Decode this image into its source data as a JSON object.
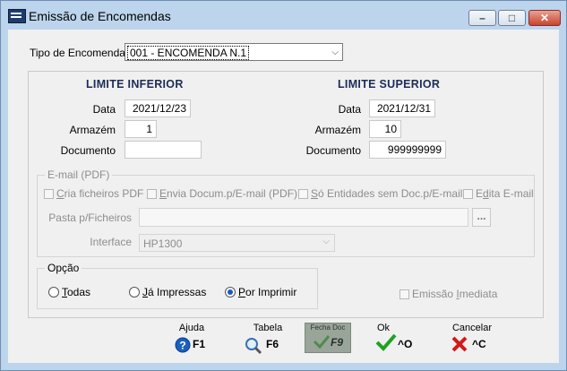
{
  "window": {
    "title": "Emissão de Encomendas"
  },
  "controls": {
    "minimize": "–",
    "maximize": "□",
    "close": "✕"
  },
  "tipo": {
    "label": "Tipo de Encomenda",
    "value": "001 - ENCOMENDA N.1"
  },
  "inferior": {
    "heading": "LIMITE INFERIOR",
    "data_label": "Data",
    "data": "2021/12/23",
    "armazem_label": "Armazém",
    "armazem": "1",
    "documento_label": "Documento",
    "documento": ""
  },
  "superior": {
    "heading": "LIMITE SUPERIOR",
    "data_label": "Data",
    "data": "2021/12/31",
    "armazem_label": "Armazém",
    "armazem": "10",
    "documento_label": "Documento",
    "documento": "999999999"
  },
  "email": {
    "caption": "E-mail (PDF)",
    "cria_pre": "",
    "cria_u": "C",
    "cria_post": "ria ficheiros PDF",
    "envia_pre": "",
    "envia_u": "E",
    "envia_post": "nvia Docum.p/E-mail (PDF)",
    "so_pre": "",
    "so_u": "S",
    "so_post": "ó Entidades sem Doc.p/E-mail",
    "edita_pre": "E",
    "edita_u": "d",
    "edita_post": "ita E-mail",
    "pasta_label": "Pasta p/Ficheiros",
    "browse": "...",
    "interface_label": "Interface",
    "interface": "HP1300"
  },
  "opcao": {
    "caption": "Opção",
    "todas_u": "T",
    "todas_post": "odas",
    "ja_u": "J",
    "ja_post": "á Impressas",
    "por_u": "P",
    "por_post": "or Imprimir",
    "selected": "por"
  },
  "emissao": {
    "pre": "Emissão ",
    "u": "I",
    "post": "mediata"
  },
  "toolbar": {
    "ajuda": {
      "caption": "Ajuda",
      "key": "F1"
    },
    "tabela": {
      "caption": "Tabela",
      "key": "F6"
    },
    "f9": {
      "caption": "Fecha Doc",
      "key": "F9"
    },
    "ok": {
      "caption": "Ok",
      "key": "^O"
    },
    "cancelar": {
      "caption": "Cancelar",
      "key": "^C"
    }
  },
  "colors": {
    "titlebar": "#bcd4ec",
    "heading": "#1c2c58",
    "ok_green": "#1fa31f",
    "cancel_red": "#d11a1a",
    "help_blue": "#1a5fc2"
  }
}
